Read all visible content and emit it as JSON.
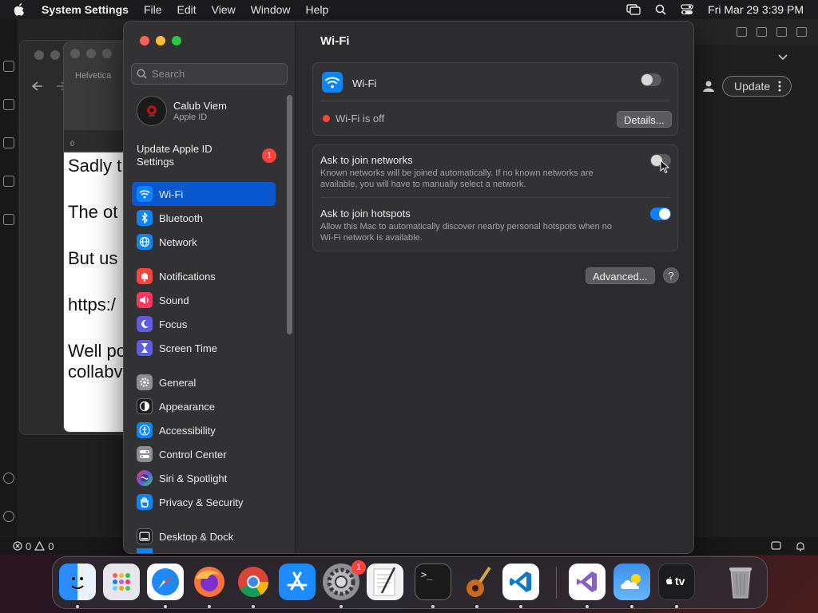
{
  "menubar": {
    "app_name": "System Settings",
    "menus": [
      "File",
      "Edit",
      "View",
      "Window",
      "Help"
    ],
    "clock": "Fri Mar 29  3:39 PM"
  },
  "background": {
    "doc_font": "Helvetica",
    "doc_ruler_zero": "0",
    "doc_lines": [
      "Sadly t",
      "The ot",
      "But us",
      "https:/",
      "Well po",
      "collabv"
    ],
    "update_button": "Update",
    "status_errors": "0",
    "status_warnings": "0"
  },
  "sidebar": {
    "search_placeholder": "Search",
    "account_name": "Calub Viem",
    "account_sub": "Apple ID",
    "update_line1": "Update Apple ID",
    "update_line2": "Settings",
    "update_badge": "1",
    "groups": [
      [
        {
          "label": "Wi-Fi",
          "icon": "wifi-icon",
          "color": "#0a84ff",
          "selected": true
        },
        {
          "label": "Bluetooth",
          "icon": "bluetooth-icon",
          "color": "#0a84ff"
        },
        {
          "label": "Network",
          "icon": "globe-icon",
          "color": "#0a84ff"
        }
      ],
      [
        {
          "label": "Notifications",
          "icon": "bell-icon",
          "color": "#ff453a"
        },
        {
          "label": "Sound",
          "icon": "speaker-icon",
          "color": "#ff375f"
        },
        {
          "label": "Focus",
          "icon": "moon-icon",
          "color": "#5e5ce6"
        },
        {
          "label": "Screen Time",
          "icon": "hourglass-icon",
          "color": "#5e5ce6"
        }
      ],
      [
        {
          "label": "General",
          "icon": "gear-icon",
          "color": "#8e8e93"
        },
        {
          "label": "Appearance",
          "icon": "appearance-icon",
          "color": "#1c1c1e"
        },
        {
          "label": "Accessibility",
          "icon": "accessibility-icon",
          "color": "#0a84ff"
        },
        {
          "label": "Control Center",
          "icon": "control-center-icon",
          "color": "#8e8e93"
        },
        {
          "label": "Siri & Spotlight",
          "icon": "siri-icon",
          "color": "#bf5af2"
        },
        {
          "label": "Privacy & Security",
          "icon": "hand-icon",
          "color": "#0a84ff"
        }
      ],
      [
        {
          "label": "Desktop & Dock",
          "icon": "dock-icon",
          "color": "#1c1c1e"
        }
      ]
    ]
  },
  "content": {
    "title": "Wi-Fi",
    "wifi_label": "Wi-Fi",
    "wifi_enabled": false,
    "status": "Wi-Fi is off",
    "status_color": "#ff453a",
    "details_button": "Details...",
    "ask_networks_title": "Ask to join networks",
    "ask_networks_desc_1": "Known networks will be joined automatically. If no known networks are",
    "ask_networks_desc_2": "available, you will have to manually select a network.",
    "ask_networks_enabled": false,
    "ask_hotspots_title": "Ask to join hotspots",
    "ask_hotspots_desc_1": "Allow this Mac to automatically discover nearby personal hotspots when no",
    "ask_hotspots_desc_2": "Wi-Fi network is available.",
    "ask_hotspots_enabled": true,
    "advanced_button": "Advanced...",
    "help_button": "?"
  },
  "dock": {
    "items": [
      {
        "name": "finder",
        "color": "#1e8fff"
      },
      {
        "name": "launchpad",
        "color": "#e9e9ee"
      },
      {
        "name": "safari",
        "color": "#1e88ff"
      },
      {
        "name": "firefox",
        "color": "#7b2fd0"
      },
      {
        "name": "chrome",
        "color": "#ffffff"
      },
      {
        "name": "app-store",
        "color": "#1c8bff"
      },
      {
        "name": "system-settings",
        "color": "#8e8e93",
        "badge": "1"
      },
      {
        "name": "textedit",
        "color": "#f2f2f2"
      },
      {
        "name": "terminal",
        "color": "#1a1a1a",
        "glyph": ">_"
      },
      {
        "name": "garageband",
        "color": "#3a3a3a"
      },
      {
        "name": "vscode",
        "color": "#ffffff"
      },
      {
        "name": "visual-studio",
        "color": "#ffffff"
      },
      {
        "name": "weather",
        "color": "#3d8fe8"
      },
      {
        "name": "apple-tv",
        "color": "#1c1c1e",
        "glyph": "tv"
      },
      {
        "name": "trash",
        "color": "#9a9aa0"
      }
    ]
  }
}
